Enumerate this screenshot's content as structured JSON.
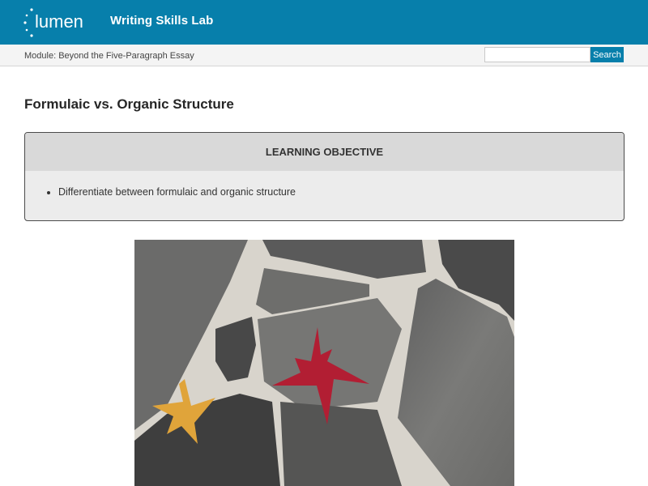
{
  "header": {
    "logo_text": "lumen",
    "site_title": "Writing Skills Lab",
    "colors": {
      "brand": "#077fab"
    }
  },
  "subheader": {
    "breadcrumb": "Module: Beyond the Five-Paragraph Essay",
    "search": {
      "placeholder": "",
      "button_label": "Search"
    }
  },
  "main": {
    "title": "Formulaic vs. Organic Structure",
    "objective": {
      "heading": "LEARNING OBJECTIVE",
      "items": [
        "Differentiate between formulaic and organic structure"
      ]
    },
    "image": {
      "icon": "photo-leaves-on-stone"
    }
  }
}
